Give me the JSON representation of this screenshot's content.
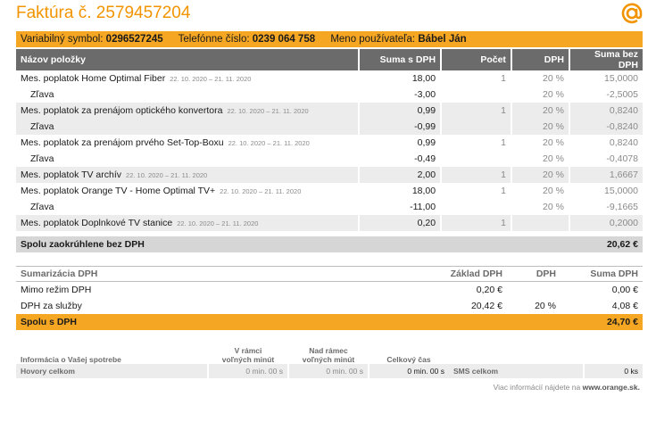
{
  "header": {
    "title": "Faktúra č. 2579457204",
    "icon": "at-icon",
    "accent_color": "#f29400"
  },
  "info_bar": {
    "vs_label": "Variabilný symbol:",
    "vs_value": "0296527245",
    "phone_label": "Telefónne číslo:",
    "phone_value": "0239 064 758",
    "user_label": "Meno používateľa:",
    "user_value": "Bábel Ján"
  },
  "items": {
    "columns": [
      "Názov položky",
      "Suma s DPH",
      "Počet",
      "DPH",
      "Suma bez DPH"
    ],
    "rows": [
      {
        "name": "Mes. poplatok Home Optimal Fiber",
        "period": "22. 10. 2020 – 21. 11. 2020",
        "sum": "18,00",
        "count": "1",
        "vat": "20 %",
        "net": "15,0000"
      },
      {
        "name": "Zľava",
        "period": "",
        "sum": "-3,00",
        "count": "",
        "vat": "20 %",
        "net": "-2,5005"
      },
      {
        "name": "Mes. poplatok za prenájom optického konvertora",
        "period": "22. 10. 2020 – 21. 11. 2020",
        "sum": "0,99",
        "count": "1",
        "vat": "20 %",
        "net": "0,8240"
      },
      {
        "name": "Zľava",
        "period": "",
        "sum": "-0,99",
        "count": "",
        "vat": "20 %",
        "net": "-0,8240"
      },
      {
        "name": "Mes. poplatok za prenájom prvého Set-Top-Boxu",
        "period": "22. 10. 2020 – 21. 11. 2020",
        "sum": "0,99",
        "count": "1",
        "vat": "20 %",
        "net": "0,8240"
      },
      {
        "name": "Zľava",
        "period": "",
        "sum": "-0,49",
        "count": "",
        "vat": "20 %",
        "net": "-0,4078"
      },
      {
        "name": "Mes. poplatok TV archív",
        "period": "22. 10. 2020 – 21. 11. 2020",
        "sum": "2,00",
        "count": "1",
        "vat": "20 %",
        "net": "1,6667"
      },
      {
        "name": "Mes. poplatok Orange TV - Home Optimal TV+",
        "period": "22. 10. 2020 – 21. 11. 2020",
        "sum": "18,00",
        "count": "1",
        "vat": "20 %",
        "net": "15,0000"
      },
      {
        "name": "Zľava",
        "period": "",
        "sum": "-11,00",
        "count": "",
        "vat": "20 %",
        "net": "-9,1665"
      },
      {
        "name": "Mes. poplatok Doplnkové TV stanice",
        "period": "22. 10. 2020 – 21. 11. 2020",
        "sum": "0,20",
        "count": "1",
        "vat": "",
        "net": "0,2000"
      }
    ]
  },
  "total_rounded": {
    "label": "Spolu zaokrúhlene bez DPH",
    "value": "20,62 €"
  },
  "vat_summary": {
    "columns": [
      "Sumarizácia DPH",
      "Základ DPH",
      "DPH",
      "Suma DPH"
    ],
    "rows": [
      {
        "label": "Mimo režim DPH",
        "base": "0,20 €",
        "rate": "",
        "amount": "0,00 €"
      },
      {
        "label": "DPH za služby",
        "base": "20,42 €",
        "rate": "20 %",
        "amount": "4,08 €"
      }
    ],
    "total_label": "Spolu s DPH",
    "total_value": "24,70 €"
  },
  "usage": {
    "info_label": "Informácia o Vašej spotrebe",
    "col_within_1": "V rámci",
    "col_within_2": "voľných minút",
    "col_over_1": "Nad rámec",
    "col_over_2": "voľných minút",
    "col_total": "Celkový čas",
    "calls_label": "Hovory celkom",
    "calls_within": "0 min. 00 s",
    "calls_over": "0 min. 00 s",
    "calls_total": "0 min. 00 s",
    "sms_label": "SMS celkom",
    "sms_value": "0 ks"
  },
  "footnote": {
    "text": "Viac informácií nájdete na",
    "link": "www.orange.sk."
  }
}
